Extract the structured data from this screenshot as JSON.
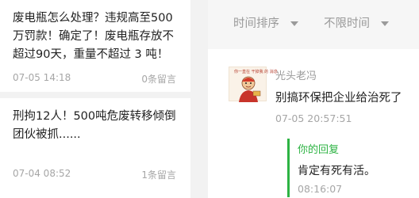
{
  "articles": [
    {
      "title": "废电瓶怎么处理？违规高至500万罚款！确定了！废电瓶存放不超过90天，重量不超过 3 吨！",
      "date": "07-05 14:18",
      "count": "0条留言"
    },
    {
      "title": "刑拘12人！500吨危废转移倾倒团伙被抓......",
      "date": "07-04 08:52",
      "count": "1条留言"
    }
  ],
  "filters": {
    "sort_label": "时间排序",
    "range_label": "不限时间"
  },
  "comment": {
    "avatar_icon": "cartoon-avatar",
    "avatar_caption": "你一直在 干掉我 的 消息",
    "username": "光头老冯",
    "text": "别搞环保把企业给治死了",
    "time": "07-05 20:57:51",
    "reply": {
      "label": "你的回复",
      "text": "肯定有死有活。",
      "time": "08:16:07"
    }
  },
  "colors": {
    "accent_green": "#2db343",
    "muted_text": "#a6a6a6",
    "body_text": "#222222"
  }
}
